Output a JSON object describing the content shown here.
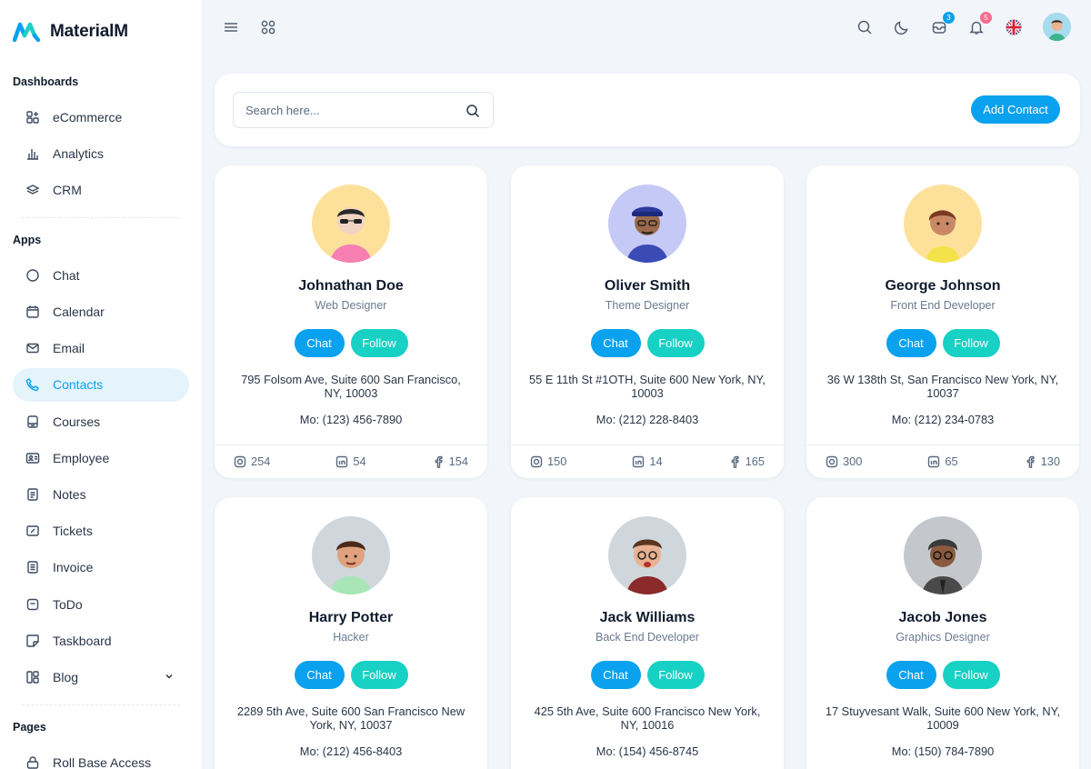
{
  "app": {
    "name": "MaterialM"
  },
  "sidebar": {
    "sections": [
      {
        "caption": "Dashboards",
        "items": [
          {
            "label": "eCommerce",
            "icon": "ecommerce-icon"
          },
          {
            "label": "Analytics",
            "icon": "analytics-icon"
          },
          {
            "label": "CRM",
            "icon": "crm-icon"
          }
        ]
      },
      {
        "caption": "Apps",
        "items": [
          {
            "label": "Chat",
            "icon": "chat-icon"
          },
          {
            "label": "Calendar",
            "icon": "calendar-icon"
          },
          {
            "label": "Email",
            "icon": "email-icon"
          },
          {
            "label": "Contacts",
            "icon": "contacts-icon",
            "active": true
          },
          {
            "label": "Courses",
            "icon": "courses-icon"
          },
          {
            "label": "Employee",
            "icon": "employee-icon"
          },
          {
            "label": "Notes",
            "icon": "notes-icon"
          },
          {
            "label": "Tickets",
            "icon": "tickets-icon"
          },
          {
            "label": "Invoice",
            "icon": "invoice-icon"
          },
          {
            "label": "ToDo",
            "icon": "todo-icon"
          },
          {
            "label": "Taskboard",
            "icon": "taskboard-icon"
          },
          {
            "label": "Blog",
            "icon": "blog-icon",
            "expandable": true
          }
        ]
      },
      {
        "caption": "Pages",
        "items": [
          {
            "label": "Roll Base Access",
            "icon": "roll-base-access-icon"
          }
        ]
      }
    ]
  },
  "topbar": {
    "messages_count": "3",
    "notifications_count": "5"
  },
  "search": {
    "placeholder": "Search here...",
    "value": ""
  },
  "add_contact_label": "Add Contact",
  "card_buttons": {
    "chat": "Chat",
    "follow": "Follow"
  },
  "contacts": [
    {
      "name": "Johnathan Doe",
      "role": "Web Designer",
      "address": "795 Folsom Ave, Suite 600 San Francisco, NY, 10003",
      "phone": "Mo: (123) 456-7890",
      "instagram": "254",
      "linkedin": "54",
      "facebook": "154"
    },
    {
      "name": "Oliver Smith",
      "role": "Theme Designer",
      "address": "55 E 11th St #1OTH, Suite 600 New York, NY, 10003",
      "phone": "Mo: (212) 228-8403",
      "instagram": "150",
      "linkedin": "14",
      "facebook": "165"
    },
    {
      "name": "George Johnson",
      "role": "Front End Developer",
      "address": "36 W 138th St, San Francisco New York, NY, 10037",
      "phone": "Mo: (212) 234-0783",
      "instagram": "300",
      "linkedin": "65",
      "facebook": "130"
    },
    {
      "name": "Harry Potter",
      "role": "Hacker",
      "address": "2289 5th Ave, Suite 600 San Francisco New York, NY, 10037",
      "phone": "Mo: (212) 456-8403"
    },
    {
      "name": "Jack Williams",
      "role": "Back End Developer",
      "address": "425 5th Ave, Suite 600 Francisco New York, NY, 10016",
      "phone": "Mo: (154) 456-8745"
    },
    {
      "name": "Jacob Jones",
      "role": "Graphics Designer",
      "address": "17 Stuyvesant Walk, Suite 600 New York, NY, 10009",
      "phone": "Mo: (150) 784-7890"
    }
  ],
  "colors": {
    "primary": "#0aa2ee",
    "secondary": "#17d1c4",
    "badge_blue": "#0aa2ee",
    "badge_pink": "#fb6c8e",
    "active_bg": "#e5f3fb"
  }
}
